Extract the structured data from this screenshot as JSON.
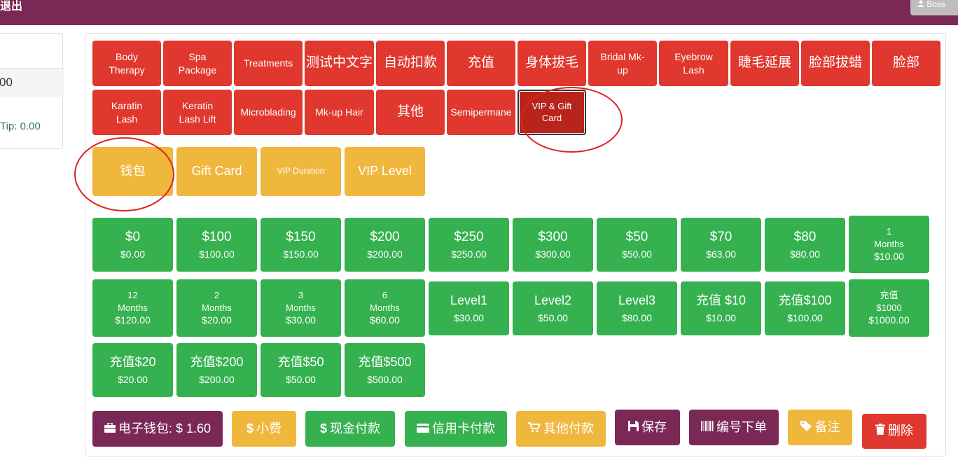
{
  "topbar": {
    "exit_label": "退出",
    "user_label": "Boss"
  },
  "left_panel": {
    "amount": "00",
    "tip": "Tip: 0.00"
  },
  "categories": [
    {
      "label": "Body Therapy",
      "label2": ""
    },
    {
      "label": "Spa Package"
    },
    {
      "label": "Treatments"
    },
    {
      "label": "测试中文字"
    },
    {
      "label": "自动扣款"
    },
    {
      "label": "充值"
    },
    {
      "label": "身体拔毛"
    },
    {
      "label": "Bridal Mk-up"
    },
    {
      "label": "Eyebrow Lash"
    },
    {
      "label": "睫毛延展"
    },
    {
      "label": "脸部拔蜡"
    },
    {
      "label": "脸部"
    },
    {
      "label": "Karatin Lash"
    },
    {
      "label": "Keratin Lash Lift"
    },
    {
      "label": "Microblading"
    },
    {
      "label": "Mk-up Hair"
    },
    {
      "label": "其他"
    },
    {
      "label": "Semipermane"
    },
    {
      "label": "VIP & Gift Card"
    }
  ],
  "subcategories": [
    {
      "label": "钱包"
    },
    {
      "label": "Gift Card"
    },
    {
      "label": "VIP Duration"
    },
    {
      "label": "VIP Level"
    }
  ],
  "items": [
    {
      "name": "$0",
      "price": "$0.00"
    },
    {
      "name": "$100",
      "price": "$100.00"
    },
    {
      "name": "$150",
      "price": "$150.00"
    },
    {
      "name": "$200",
      "price": "$200.00"
    },
    {
      "name": "$250",
      "price": "$250.00"
    },
    {
      "name": "$300",
      "price": "$300.00"
    },
    {
      "name": "$50",
      "price": "$50.00"
    },
    {
      "name": "$70",
      "price": "$63.00"
    },
    {
      "name": "$80",
      "price": "$80.00"
    },
    {
      "name": "1",
      "name2": "Months",
      "price": "$10.00"
    },
    {
      "name": "12",
      "name2": "Months",
      "price": "$120.00"
    },
    {
      "name": "2",
      "name2": "Months",
      "price": "$20.00"
    },
    {
      "name": "3",
      "name2": "Months",
      "price": "$30.00"
    },
    {
      "name": "6",
      "name2": "Months",
      "price": "$60.00"
    },
    {
      "name": "Level1",
      "price": "$30.00"
    },
    {
      "name": "Level2",
      "price": "$50.00"
    },
    {
      "name": "Level3",
      "price": "$80.00"
    },
    {
      "name": "充值 $10",
      "price": "$10.00"
    },
    {
      "name": "充值$100",
      "price": "$100.00"
    },
    {
      "name": "充值",
      "name2": "$1000",
      "price": "$1000.00"
    },
    {
      "name": "充值$20",
      "price": "$20.00"
    },
    {
      "name": "充值$200",
      "price": "$200.00"
    },
    {
      "name": "充值$50",
      "price": "$50.00"
    },
    {
      "name": "充值$500",
      "price": "$500.00"
    }
  ],
  "actions": {
    "wallet": "电子钱包: $ 1.60",
    "tip": "小费",
    "cash": "现金付款",
    "card": "信用卡付款",
    "other": "其他付款",
    "save": "保存",
    "code_order": "编号下单",
    "note": "备注",
    "delete": "删除"
  },
  "colors": {
    "header": "#7a2855",
    "category": "#e0372e",
    "subcategory": "#f0b73d",
    "item": "#35b14f",
    "annotation": "#e0241b"
  },
  "icons": {
    "wallet": "briefcase-icon",
    "tip": "dollar-icon",
    "cash": "dollar-icon",
    "card": "credit-card-icon",
    "other": "cart-icon",
    "save": "floppy-icon",
    "code_order": "barcode-icon",
    "note": "tag-icon",
    "delete": "trash-icon",
    "user": "user-icon"
  }
}
